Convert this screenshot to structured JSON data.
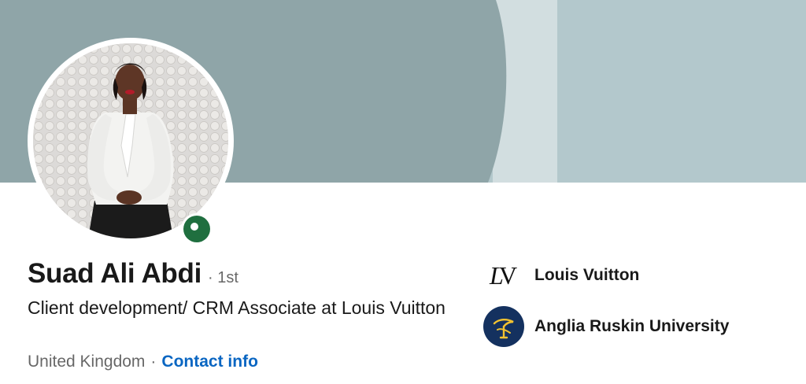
{
  "banner": {
    "colors": {
      "left": "#8fa5a8",
      "middle": "#d2dee0",
      "right": "#b3c8cc"
    }
  },
  "profile": {
    "name": "Suad Ali Abdi",
    "degree": "· 1st",
    "headline": "Client development/ CRM Associate at Louis Vuitton",
    "location": "United Kingdom",
    "separator": "·",
    "contact_label": "Contact info",
    "status": "online",
    "status_color": "#1f6f3f",
    "link_color": "#0a66c2"
  },
  "organizations": [
    {
      "name": "Louis Vuitton",
      "logo_icon": "lv-monogram-icon",
      "logo_text": "LV"
    },
    {
      "name": "Anglia Ruskin University",
      "logo_icon": "aru-crest-icon",
      "logo_color": "#14315f"
    }
  ]
}
